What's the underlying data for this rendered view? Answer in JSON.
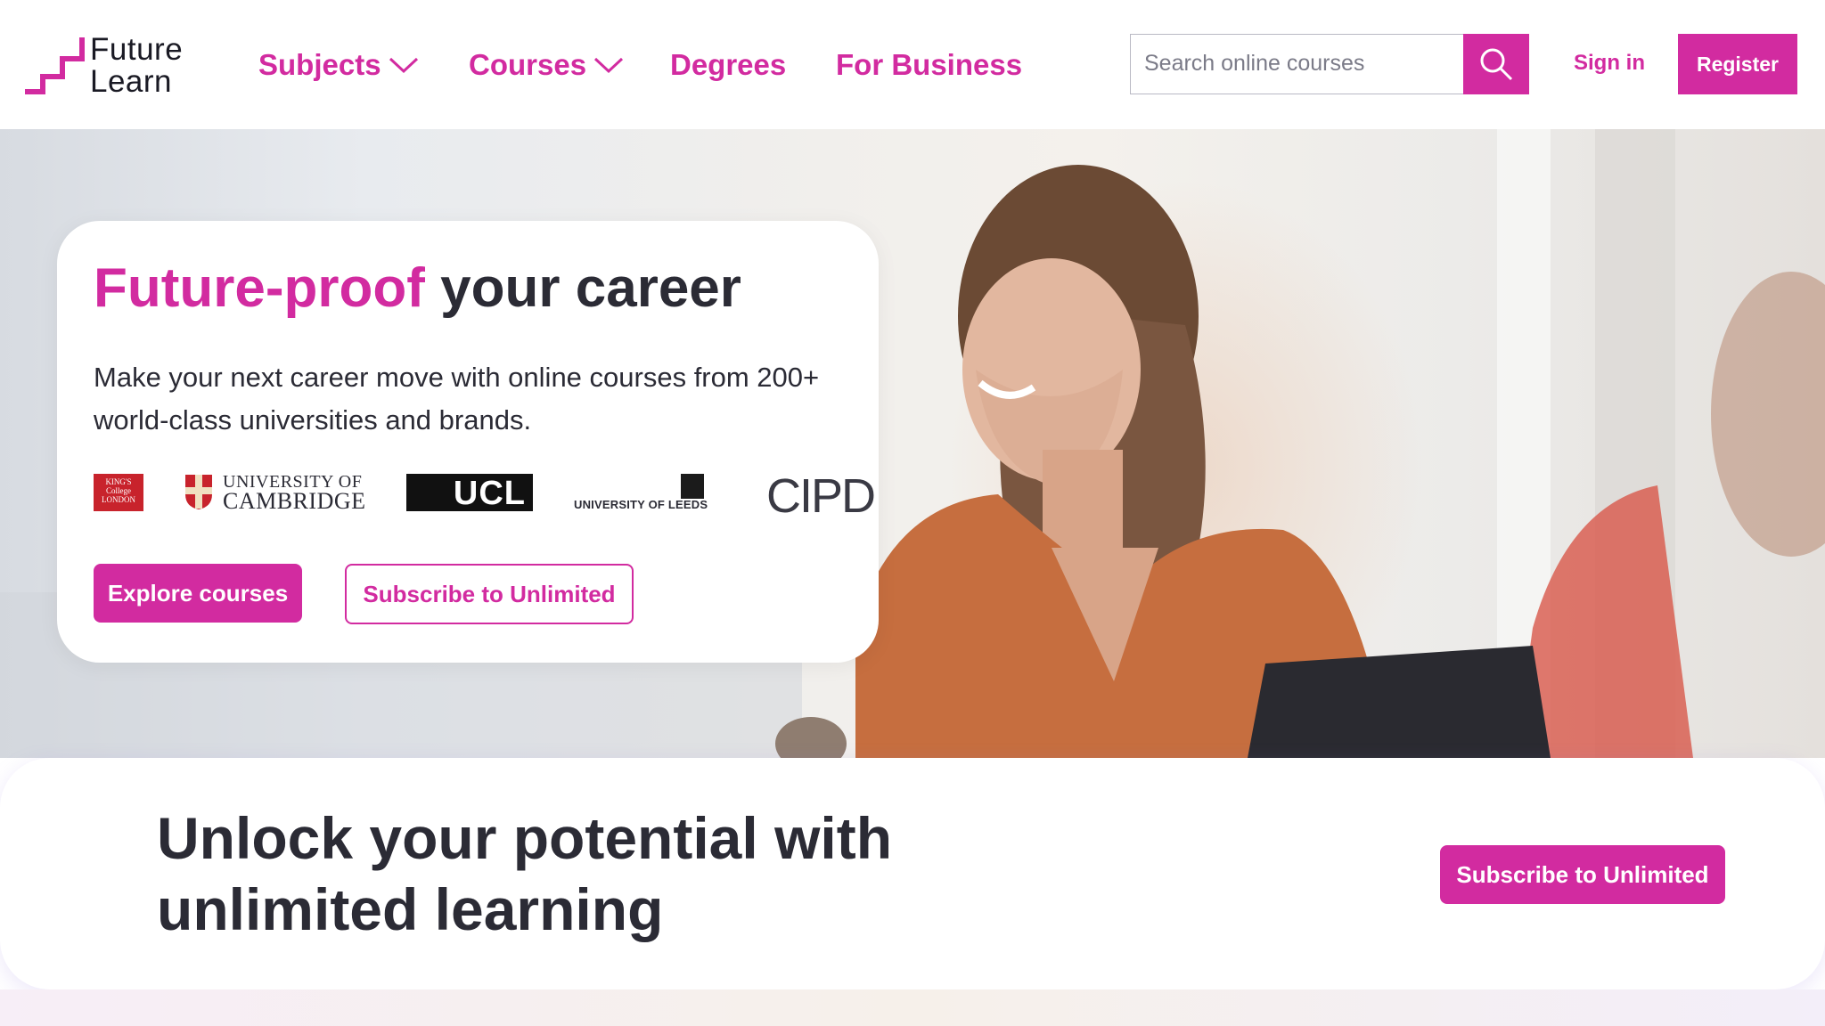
{
  "brand": {
    "logo_line1": "Future",
    "logo_line2": "Learn",
    "accent_color": "#d22ba0"
  },
  "nav": {
    "subjects": "Subjects",
    "courses": "Courses",
    "degrees": "Degrees",
    "business": "For Business"
  },
  "search": {
    "placeholder": "Search online courses"
  },
  "auth": {
    "sign_in": "Sign in",
    "register": "Register"
  },
  "hero": {
    "title_accent": "Future-proof",
    "title_rest": " your career",
    "subtitle": "Make your next career move with online courses from 200+ world-class universities and brands.",
    "partners": {
      "kings": "KING'S College LONDON",
      "cambridge_line1": "UNIVERSITY OF",
      "cambridge_line2": "CAMBRIDGE",
      "ucl": "UCL",
      "leeds": "UNIVERSITY OF LEEDS",
      "cipd": "CIPD"
    },
    "explore_button": "Explore courses",
    "subscribe_button": "Subscribe to Unlimited"
  },
  "banner": {
    "title": "Unlock your potential with unlimited learning",
    "button": "Subscribe to Unlimited"
  }
}
